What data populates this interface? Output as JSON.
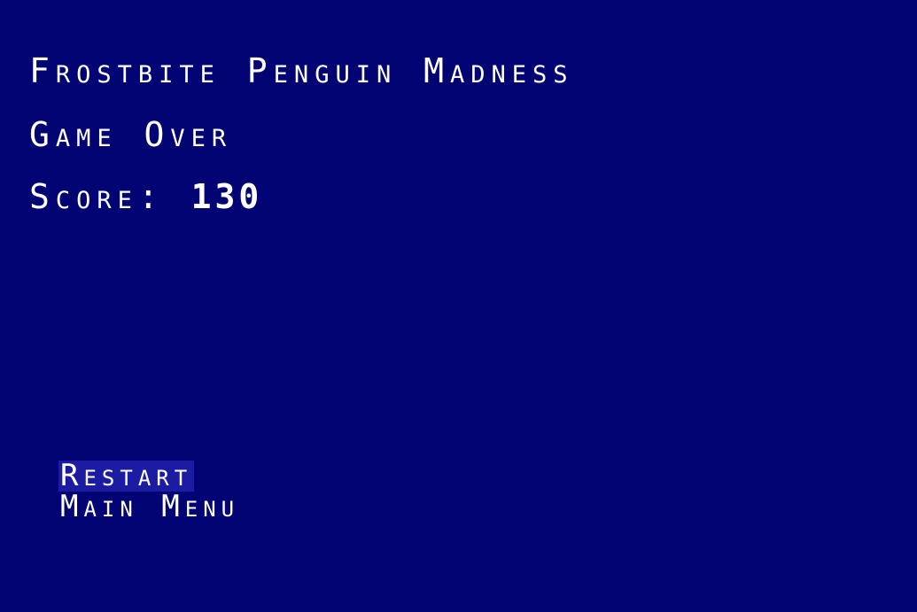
{
  "game": {
    "title": "Frostbite Penguin Madness",
    "status": "Game Over",
    "score_label": "Score: ",
    "score_value": "130"
  },
  "menu": {
    "items": [
      {
        "label": "Restart",
        "selected": true
      },
      {
        "label": "Main Menu",
        "selected": false
      }
    ]
  },
  "colors": {
    "background": "#020474",
    "text": "#ffffff",
    "selection_highlight": "#1c1ca2"
  }
}
